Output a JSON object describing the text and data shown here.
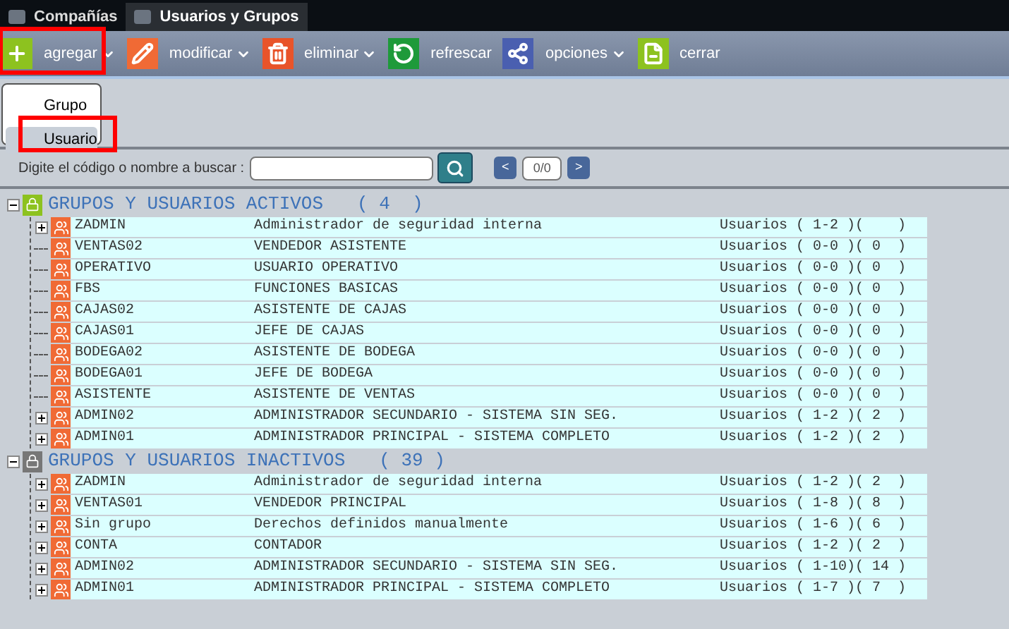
{
  "tabs": [
    {
      "label": "Compañías",
      "selected": false
    },
    {
      "label": "Usuarios y Grupos",
      "selected": true
    }
  ],
  "toolbar": [
    {
      "label": "agregar",
      "kind": "add",
      "has_menu": true,
      "highlighted": true
    },
    {
      "label": "modificar",
      "kind": "edit",
      "has_menu": true,
      "highlighted": false
    },
    {
      "label": "eliminar",
      "kind": "delete",
      "has_menu": true,
      "highlighted": false
    },
    {
      "label": "refrescar",
      "kind": "refresh",
      "has_menu": false,
      "highlighted": false
    },
    {
      "label": "opciones",
      "kind": "options",
      "has_menu": true,
      "highlighted": false
    },
    {
      "label": "cerrar",
      "kind": "close",
      "has_menu": false,
      "highlighted": false
    }
  ],
  "menu": [
    {
      "label": "Grupo",
      "selected": false,
      "highlighted": false
    },
    {
      "label": "Usuario",
      "selected": true,
      "highlighted": true
    }
  ],
  "search": {
    "label": "Digite el código o nombre a buscar :",
    "pager": "0/0",
    "prev": "<",
    "next": ">"
  },
  "groups": [
    {
      "title": "GRUPOS Y USUARIOS ACTIVOS",
      "count": "( 4  )",
      "kind": "active",
      "expanded": true,
      "rows": [
        {
          "code": "ZADMIN",
          "description": "Administrador de seguridad interna",
          "users": "Usuarios ( 1-2 )(    )",
          "has_children": true
        },
        {
          "code": "VENTAS02",
          "description": "VENDEDOR ASISTENTE",
          "users": "Usuarios ( 0-0 )( 0  )",
          "has_children": false
        },
        {
          "code": "OPERATIVO",
          "description": "USUARIO OPERATIVO",
          "users": "Usuarios ( 0-0 )( 0  )",
          "has_children": false
        },
        {
          "code": "FBS",
          "description": "FUNCIONES BASICAS",
          "users": "Usuarios ( 0-0 )( 0  )",
          "has_children": false
        },
        {
          "code": "CAJAS02",
          "description": "ASISTENTE DE CAJAS",
          "users": "Usuarios ( 0-0 )( 0  )",
          "has_children": false
        },
        {
          "code": "CAJAS01",
          "description": "JEFE DE CAJAS",
          "users": "Usuarios ( 0-0 )( 0  )",
          "has_children": false
        },
        {
          "code": "BODEGA02",
          "description": "ASISTENTE DE BODEGA",
          "users": "Usuarios ( 0-0 )( 0  )",
          "has_children": false
        },
        {
          "code": "BODEGA01",
          "description": "JEFE DE BODEGA",
          "users": "Usuarios ( 0-0 )( 0  )",
          "has_children": false
        },
        {
          "code": "ASISTENTE",
          "description": "ASISTENTE DE VENTAS",
          "users": "Usuarios ( 0-0 )( 0  )",
          "has_children": false
        },
        {
          "code": "ADMIN02",
          "description": "ADMINISTRADOR SECUNDARIO - SISTEMA SIN SEG.",
          "users": "Usuarios ( 1-2 )( 2  )",
          "has_children": true
        },
        {
          "code": "ADMIN01",
          "description": "ADMINISTRADOR PRINCIPAL - SISTEMA COMPLETO",
          "users": "Usuarios ( 1-2 )( 2  )",
          "has_children": true
        }
      ]
    },
    {
      "title": "GRUPOS Y USUARIOS INACTIVOS",
      "count": "( 39 )",
      "kind": "inactive",
      "expanded": true,
      "rows": [
        {
          "code": "ZADMIN",
          "description": "Administrador de seguridad interna",
          "users": "Usuarios ( 1-2 )( 2  )",
          "has_children": true
        },
        {
          "code": "VENTAS01",
          "description": "VENDEDOR PRINCIPAL",
          "users": "Usuarios ( 1-8 )( 8  )",
          "has_children": true
        },
        {
          "code": "Sin grupo",
          "description": "Derechos definidos manualmente",
          "users": "Usuarios ( 1-6 )( 6  )",
          "has_children": true
        },
        {
          "code": "CONTA",
          "description": "CONTADOR",
          "users": "Usuarios ( 1-2 )( 2  )",
          "has_children": true
        },
        {
          "code": "ADMIN02",
          "description": "ADMINISTRADOR SECUNDARIO - SISTEMA SIN SEG.",
          "users": "Usuarios ( 1-10)( 14 )",
          "has_children": true
        },
        {
          "code": "ADMIN01",
          "description": "ADMINISTRADOR PRINCIPAL - SISTEMA COMPLETO",
          "users": "Usuarios ( 1-7 )( 7  )",
          "has_children": true
        }
      ]
    }
  ]
}
